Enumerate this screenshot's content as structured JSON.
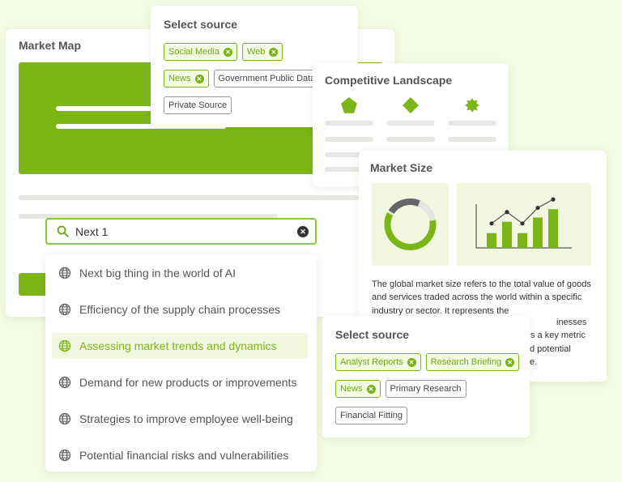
{
  "market_map": {
    "title": "Market Map"
  },
  "source_top": {
    "title": "Select source",
    "chips": [
      {
        "label": "Social Media",
        "selected": true
      },
      {
        "label": "Web",
        "selected": true
      },
      {
        "label": "News",
        "selected": true
      },
      {
        "label": "Government Public Data",
        "selected": false
      },
      {
        "label": "Private Source",
        "selected": false
      }
    ]
  },
  "competitive": {
    "title": "Competitive Landscape"
  },
  "market_size": {
    "title": "Market Size",
    "description": "The global market size refers to the total value of goods and services traded across the world within a specific industry or sector. It represents the",
    "frag1": "inesses",
    "frag2": "s a key metric",
    "frag3": "d potential",
    "frag4": "e.",
    "donut_fraction": 0.62,
    "bars": [
      0.35,
      0.62,
      0.35,
      0.72,
      0.92
    ]
  },
  "search": {
    "value": "Next 1",
    "suggestions": [
      "Next big thing in the world of AI",
      "Efficiency of the supply chain processes",
      "Assessing market trends and dynamics",
      "Demand for new products or improvements",
      "Strategies to improve employee well-being",
      "Potential financial risks and vulnerabilities"
    ],
    "highlighted_index": 2
  },
  "source_bottom": {
    "title": "Select source",
    "chips": [
      {
        "label": "Analyst Reports",
        "selected": true
      },
      {
        "label": "Research Briefing",
        "selected": true
      },
      {
        "label": "News",
        "selected": true
      },
      {
        "label": "Primary Research",
        "selected": false
      },
      {
        "label": "Financial Fitting",
        "selected": false
      }
    ]
  },
  "colors": {
    "accent": "#7cb518",
    "accent_bg": "#f1f8df",
    "page_bg": "#f3fbe2"
  }
}
